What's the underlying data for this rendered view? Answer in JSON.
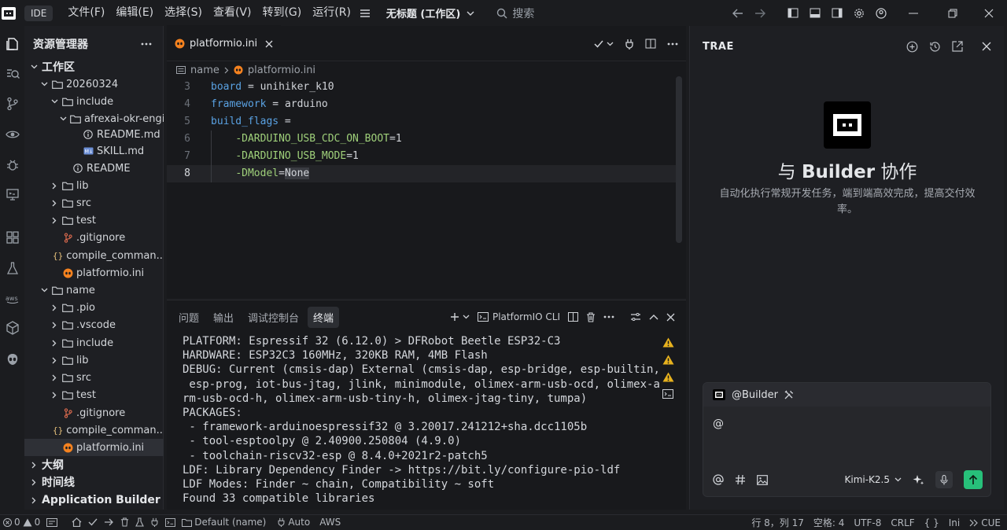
{
  "titlebar": {
    "badge": "IDE",
    "menus": [
      "文件(F)",
      "编辑(E)",
      "选择(S)",
      "查看(V)",
      "转到(G)",
      "运行(R)"
    ],
    "workspace_title": "无标题 (工作区)",
    "search_label": "搜索"
  },
  "sidebar": {
    "title": "资源管理器",
    "rows": [
      {
        "label": "工作区",
        "depth": 0,
        "type": "section",
        "open": true
      },
      {
        "label": "20260324",
        "depth": 1,
        "type": "folder",
        "open": true
      },
      {
        "label": "include",
        "depth": 2,
        "type": "folder",
        "open": true
      },
      {
        "label": "afrexai-okr-engi...",
        "depth": 3,
        "type": "folder",
        "open": true
      },
      {
        "label": "README.md",
        "depth": 4,
        "type": "info"
      },
      {
        "label": "SKILL.md",
        "depth": 4,
        "type": "md"
      },
      {
        "label": "README",
        "depth": 3,
        "type": "info"
      },
      {
        "label": "lib",
        "depth": 2,
        "type": "folder",
        "open": false
      },
      {
        "label": "src",
        "depth": 2,
        "type": "folder",
        "open": false
      },
      {
        "label": "test",
        "depth": 2,
        "type": "folder",
        "open": false
      },
      {
        "label": ".gitignore",
        "depth": 2,
        "type": "git"
      },
      {
        "label": "compile_comman...",
        "depth": 2,
        "type": "json"
      },
      {
        "label": "platformio.ini",
        "depth": 2,
        "type": "pio"
      },
      {
        "label": "name",
        "depth": 1,
        "type": "folder",
        "open": true
      },
      {
        "label": ".pio",
        "depth": 2,
        "type": "folder",
        "open": false
      },
      {
        "label": ".vscode",
        "depth": 2,
        "type": "folder",
        "open": false
      },
      {
        "label": "include",
        "depth": 2,
        "type": "folder",
        "open": false
      },
      {
        "label": "lib",
        "depth": 2,
        "type": "folder",
        "open": false
      },
      {
        "label": "src",
        "depth": 2,
        "type": "folder",
        "open": false
      },
      {
        "label": "test",
        "depth": 2,
        "type": "folder",
        "open": false
      },
      {
        "label": ".gitignore",
        "depth": 2,
        "type": "git"
      },
      {
        "label": "compile_comman...",
        "depth": 2,
        "type": "json"
      },
      {
        "label": "platformio.ini",
        "depth": 2,
        "type": "pio",
        "selected": true
      },
      {
        "label": "大纲",
        "depth": 0,
        "type": "section",
        "open": false
      },
      {
        "label": "时间线",
        "depth": 0,
        "type": "section",
        "open": false
      },
      {
        "label": "Application Builder",
        "depth": 0,
        "type": "section",
        "open": false
      }
    ]
  },
  "editor": {
    "tab_label": "platformio.ini",
    "breadcrumb": [
      "name",
      "platformio.ini"
    ],
    "lines": [
      {
        "num": "3",
        "key": "board",
        "op": " = ",
        "val": "unihiker_k10"
      },
      {
        "num": "4",
        "key": "framework",
        "op": " = ",
        "val": "arduino"
      },
      {
        "num": "5",
        "key": "build_flags",
        "op": " =",
        "val": ""
      },
      {
        "num": "6",
        "indent": "    ",
        "flag": "-DARDUINO_USB_CDC_ON_BOOT",
        "op": "=",
        "val": "1"
      },
      {
        "num": "7",
        "indent": "    ",
        "flag": "-DARDUINO_USB_MODE",
        "op": "=",
        "val": "1"
      },
      {
        "num": "8",
        "indent": "    ",
        "flag": "-DModel",
        "op": "=",
        "val": "None",
        "current": true
      }
    ]
  },
  "panel": {
    "tabs": [
      "问题",
      "输出",
      "调试控制台",
      "终端"
    ],
    "active_tab": "终端",
    "terminal_name": "PlatformIO CLI",
    "terminal_lines": [
      "PLATFORM: Espressif 32 (6.12.0) > DFRobot Beetle ESP32-C3",
      "HARDWARE: ESP32C3 160MHz, 320KB RAM, 4MB Flash",
      "DEBUG: Current (cmsis-dap) External (cmsis-dap, esp-bridge, esp-builtin,",
      " esp-prog, iot-bus-jtag, jlink, minimodule, olimex-arm-usb-ocd, olimex-a",
      "rm-usb-ocd-h, olimex-arm-usb-tiny-h, olimex-jtag-tiny, tumpa)",
      "PACKAGES:",
      " - framework-arduinoespressif32 @ 3.20017.241212+sha.dcc1105b",
      " - tool-esptoolpy @ 2.40900.250804 (4.9.0)",
      " - toolchain-riscv32-esp @ 8.4.0+2021r2-patch5",
      "LDF: Library Dependency Finder -> https://bit.ly/configure-pio-ldf",
      "LDF Modes: Finder ~ chain, Compatibility ~ soft",
      "Found 33 compatible libraries"
    ]
  },
  "ai_panel": {
    "title": "TRAE",
    "heading_prefix": "与 ",
    "heading_bold": "Builder",
    "heading_suffix": " 协作",
    "description": "自动化执行常规开发任务，端到端高效完成，提高交付效率。",
    "agent_label": "@Builder",
    "input_value": "@",
    "model": "Kimi-K2.5"
  },
  "statusbar": {
    "errors": "0",
    "warnings": "0",
    "profile": "Default (name)",
    "auto": "Auto",
    "aws": "AWS",
    "position": "行 8，列 17",
    "spaces": "空格: 4",
    "encoding": "UTF-8",
    "eol": "CRLF",
    "braces": "{ }",
    "language": "Ini",
    "cue": "CUE"
  },
  "colors": {
    "accent_green": "#27c07a",
    "warning": "#e8b21e",
    "pio_orange": "#f5821f"
  }
}
